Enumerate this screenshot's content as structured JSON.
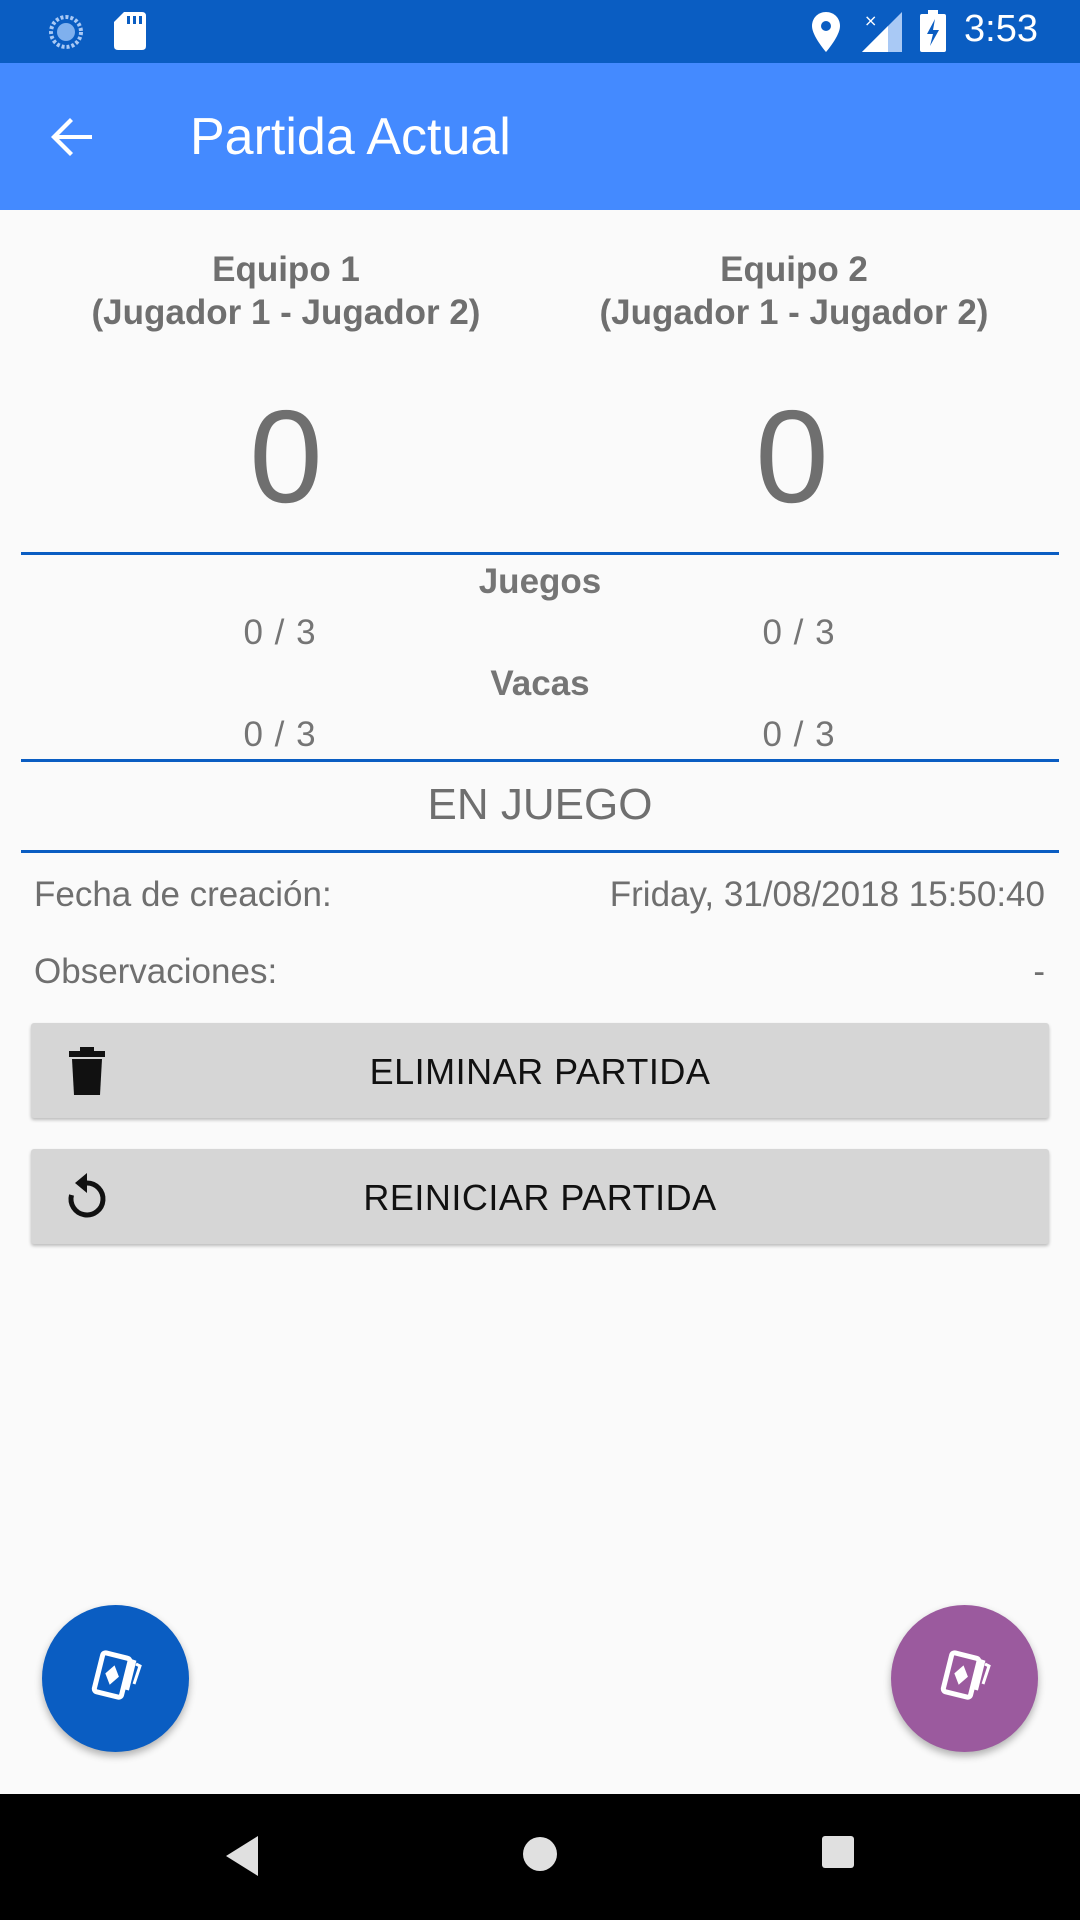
{
  "status_bar": {
    "time": "3:53",
    "icons": [
      "sync-icon",
      "sd-card-icon",
      "location-icon",
      "signal-icon",
      "battery-charging-icon"
    ]
  },
  "app_bar": {
    "title": "Partida Actual",
    "back_icon": "arrow-back-icon"
  },
  "teams": [
    {
      "name": "Equipo 1",
      "players": "(Jugador 1 - Jugador 2)",
      "score": "0",
      "juegos": "0 / 3",
      "vacas": "0 / 3"
    },
    {
      "name": "Equipo 2",
      "players": "(Jugador 1 - Jugador 2)",
      "score": "0",
      "juegos": "0 / 3",
      "vacas": "0 / 3"
    }
  ],
  "sections": {
    "juegos_label": "Juegos",
    "vacas_label": "Vacas"
  },
  "state": "EN JUEGO",
  "info": {
    "fecha_label": "Fecha de creación:",
    "fecha_value": "Friday, 31/08/2018 15:50:40",
    "observaciones_label": "Observaciones:",
    "observaciones_value": "-"
  },
  "buttons": {
    "eliminar": {
      "label": "ELIMINAR PARTIDA",
      "icon": "trash-icon"
    },
    "reiniciar": {
      "label": "REINICIAR PARTIDA",
      "icon": "restart-icon"
    }
  },
  "fabs": [
    {
      "icon": "cards-icon",
      "color": "#0a5dc2"
    },
    {
      "icon": "cards-icon",
      "color": "#9b5a9e"
    }
  ],
  "colors": {
    "status_bar": "#0a5dc2",
    "app_bar": "#448aff",
    "divider": "#0a5dc2",
    "fab_team1": "#0a5dc2",
    "fab_team2": "#9b5a9e"
  },
  "nav_bar": {
    "icons": [
      "nav-back-icon",
      "nav-home-icon",
      "nav-recents-icon"
    ]
  }
}
